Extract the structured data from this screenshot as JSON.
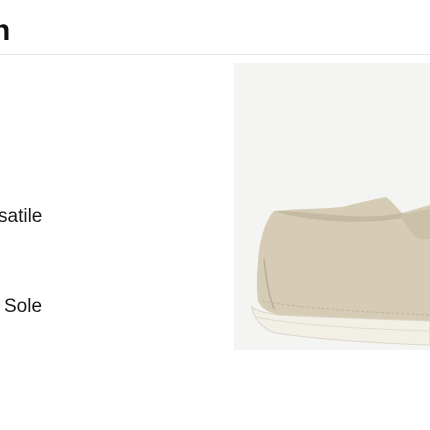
{
  "header": {
    "title": "n"
  },
  "features": [
    {
      "text": "satile"
    },
    {
      "text": " Sole"
    }
  ],
  "product_image": {
    "subject": "beige-suede-loafer",
    "colors": {
      "background": "#f4f4f3",
      "suede": "#d6ccb6",
      "suede_shadow": "#c4b9a1",
      "sole": "#f2efe6"
    }
  }
}
